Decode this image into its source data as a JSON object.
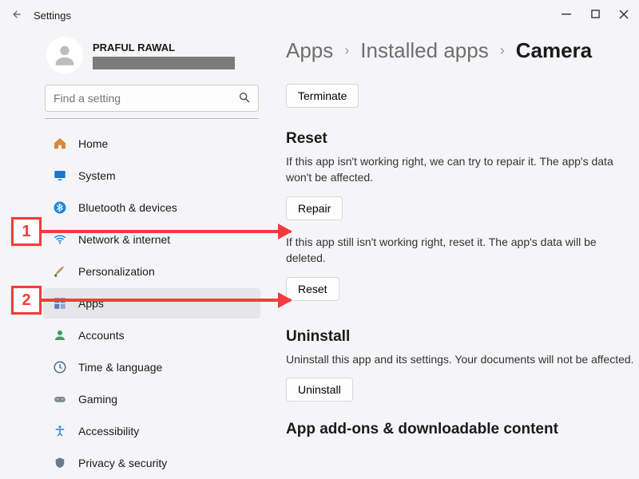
{
  "titlebar": {
    "title": "Settings"
  },
  "user": {
    "name": "PRAFUL RAWAL"
  },
  "search": {
    "placeholder": "Find a setting"
  },
  "sidebar": {
    "items": [
      {
        "label": "Home",
        "icon": "home"
      },
      {
        "label": "System",
        "icon": "system"
      },
      {
        "label": "Bluetooth & devices",
        "icon": "bluetooth"
      },
      {
        "label": "Network & internet",
        "icon": "wifi"
      },
      {
        "label": "Personalization",
        "icon": "brush"
      },
      {
        "label": "Apps",
        "icon": "apps",
        "selected": true
      },
      {
        "label": "Accounts",
        "icon": "accounts"
      },
      {
        "label": "Time & language",
        "icon": "time"
      },
      {
        "label": "Gaming",
        "icon": "gaming"
      },
      {
        "label": "Accessibility",
        "icon": "accessibility"
      },
      {
        "label": "Privacy & security",
        "icon": "privacy"
      }
    ]
  },
  "breadcrumb": {
    "path": [
      "Apps",
      "Installed apps"
    ],
    "current": "Camera"
  },
  "buttons": {
    "terminate": "Terminate",
    "repair": "Repair",
    "reset": "Reset",
    "uninstall": "Uninstall"
  },
  "sections": {
    "reset": {
      "heading": "Reset",
      "repair_desc": "If this app isn't working right, we can try to repair it. The app's data won't be affected.",
      "reset_desc": "If this app still isn't working right, reset it. The app's data will be deleted."
    },
    "uninstall": {
      "heading": "Uninstall",
      "desc": "Uninstall this app and its settings. Your documents will not be affected."
    },
    "addons": {
      "heading": "App add-ons & downloadable content"
    }
  },
  "annotations": {
    "label1": "1",
    "label2": "2"
  }
}
